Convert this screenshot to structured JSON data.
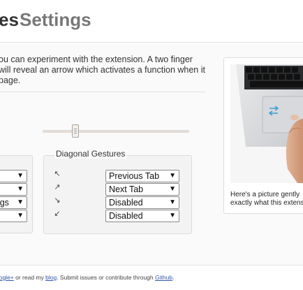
{
  "header": {
    "title_part1": "es",
    "title_part2": "Settings"
  },
  "intro": {
    "line1": "ou can experiment with the extension. A two finger",
    "line2": " will reveal an arrow which activates a function when it",
    "line3": "page."
  },
  "slider": {
    "level": 0.2
  },
  "left_group": {
    "selects": [
      "",
      "",
      "ings",
      ""
    ]
  },
  "diagonal": {
    "legend": "Diagonal Gestures",
    "rows": [
      {
        "icon": "arrow-up-left-icon",
        "glyph": "↖",
        "value": "Previous Tab"
      },
      {
        "icon": "arrow-up-right-icon",
        "glyph": "↗",
        "value": "Next Tab"
      },
      {
        "icon": "arrow-down-right-icon",
        "glyph": "↘",
        "value": "Disabled"
      },
      {
        "icon": "arrow-down-left-icon",
        "glyph": "↙",
        "value": "Disabled"
      }
    ]
  },
  "photo": {
    "caption_line1": "Here's a picture gently",
    "caption_line2": "exactly what this extens"
  },
  "footer": {
    "link1": "oogle+",
    "text1": " or read my ",
    "link2": "blog",
    "text2": ". Submit issues or contribute through ",
    "link3": "Github",
    "text3": "."
  },
  "colors": {
    "title_dark": "#333333",
    "title_light": "#777777",
    "link": "#3355aa"
  }
}
